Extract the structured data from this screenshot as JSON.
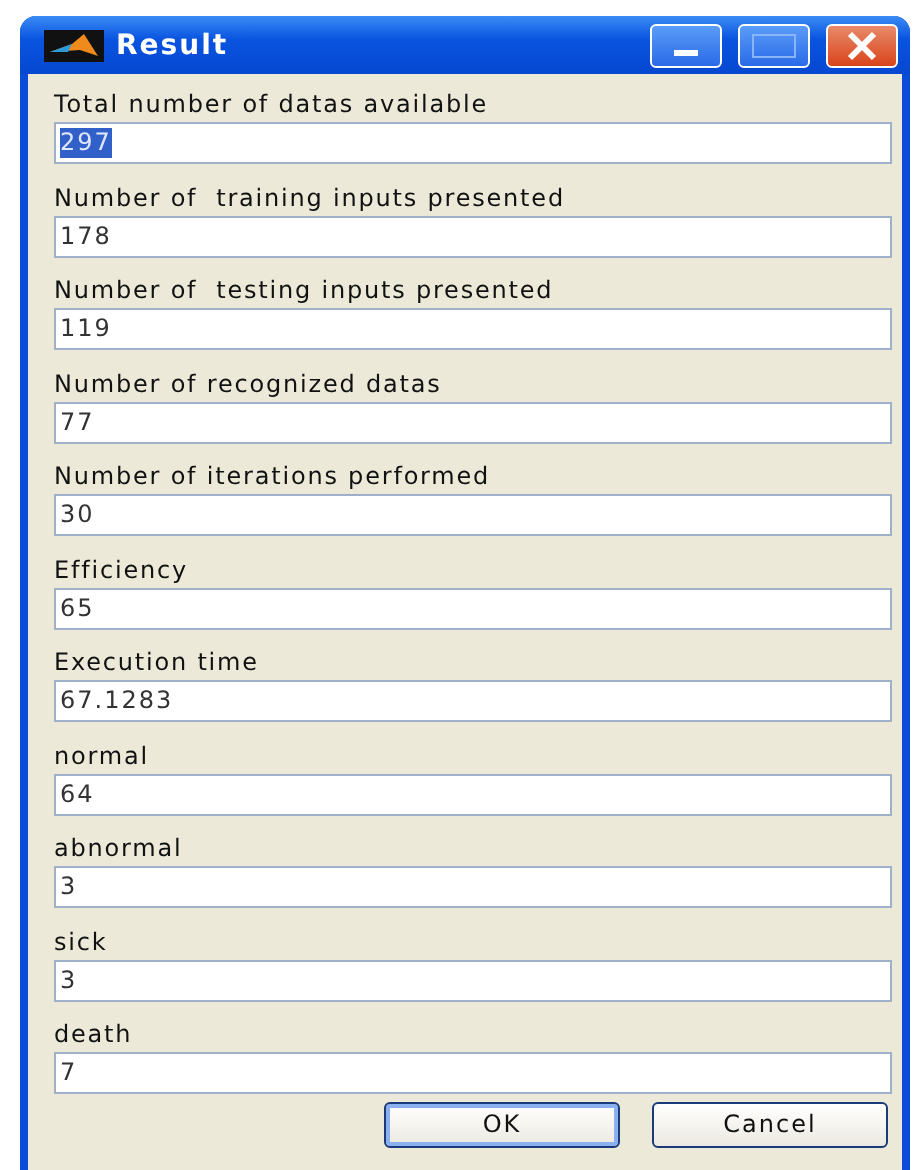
{
  "window": {
    "title": "Result"
  },
  "fields": [
    {
      "label": "Total number of datas available",
      "value": "297",
      "text_selected": true
    },
    {
      "label": "Number of  training inputs presented",
      "value": "178",
      "text_selected": false
    },
    {
      "label": "Number of  testing inputs presented",
      "value": "119",
      "text_selected": false
    },
    {
      "label": "Number of recognized datas",
      "value": "77",
      "text_selected": false
    },
    {
      "label": "Number of iterations performed",
      "value": "30",
      "text_selected": false
    },
    {
      "label": "Efficiency",
      "value": "65",
      "text_selected": false
    },
    {
      "label": "Execution time",
      "value": "67.1283",
      "text_selected": false
    },
    {
      "label": "normal",
      "value": "64",
      "text_selected": false
    },
    {
      "label": "abnormal",
      "value": "3",
      "text_selected": false
    },
    {
      "label": "sick",
      "value": "3",
      "text_selected": false
    },
    {
      "label": "death",
      "value": "7",
      "text_selected": false
    }
  ],
  "buttons": [
    {
      "label": "OK",
      "default": true
    },
    {
      "label": "Cancel",
      "default": false
    }
  ]
}
